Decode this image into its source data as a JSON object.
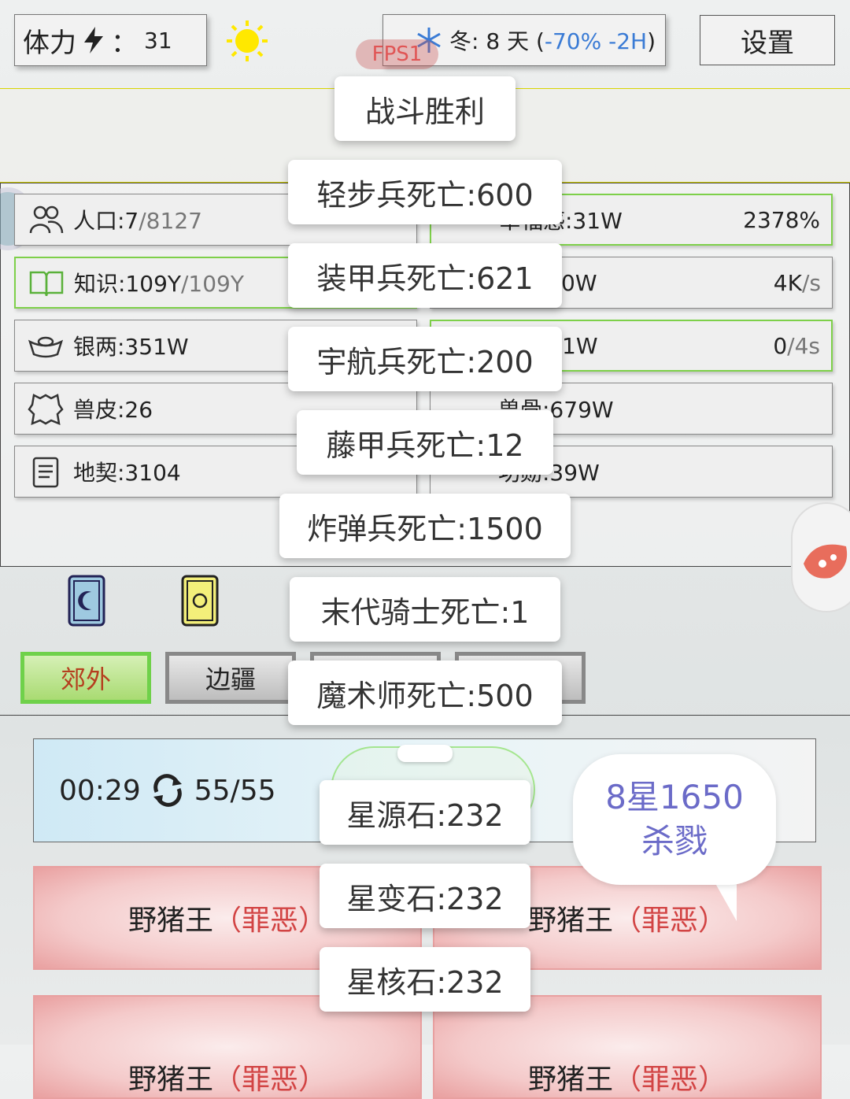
{
  "topbar": {
    "stamina_label": "体力",
    "stamina_sep": "：",
    "stamina_value": "31",
    "season_name": "冬",
    "season_days": ": 8 天 (",
    "season_mod": "-70% -2H",
    "season_close": ")",
    "settings_label": "设置",
    "fps_label": "FPS1"
  },
  "resources": {
    "left": [
      {
        "label": "人口:7",
        "max": "/8127",
        "icon": "people-icon"
      },
      {
        "label": "知识:109Y",
        "max": "/109Y",
        "icon": "book-icon"
      },
      {
        "label": "银两:351W",
        "max": "",
        "icon": "silver-ingot-icon"
      },
      {
        "label": "兽皮:26",
        "max": "",
        "icon": "fur-icon"
      },
      {
        "label": "地契:3104",
        "max": "",
        "icon": "scroll-icon"
      }
    ],
    "right": [
      {
        "label": "幸福感:31W",
        "value": "2378%"
      },
      {
        "label": "0W",
        "value": "4K",
        "unit": "/s"
      },
      {
        "label": "1W",
        "value": "0",
        "unit": "/4s"
      },
      {
        "label": "兽骨:679W",
        "value": ""
      },
      {
        "label": "功勋:39W",
        "value": ""
      }
    ]
  },
  "tabs": [
    "郊外",
    "边疆",
    "",
    ""
  ],
  "battle": {
    "timer": "00:29",
    "waves": "55/55"
  },
  "enemies": [
    "野猪王",
    "野猪王",
    "野猪王",
    "野猪王"
  ],
  "enemy_tag": "（罪恶）",
  "toasts": [
    "战斗胜利",
    "轻步兵死亡:600",
    "装甲兵死亡:621",
    "宇航兵死亡:200",
    "藤甲兵死亡:12",
    "炸弹兵死亡:1500",
    "末代骑士死亡:1",
    "魔术师死亡:500",
    "星源石:232",
    "星变石:232",
    "星核石:232"
  ],
  "bubble": {
    "line1": "8星1650",
    "line2": "杀戮"
  },
  "colors": {
    "accent_green": "#7ed04a",
    "mod_blue": "#3a7bd5",
    "enemy_red": "#d24444",
    "bubble_text": "#6b6bc8"
  }
}
